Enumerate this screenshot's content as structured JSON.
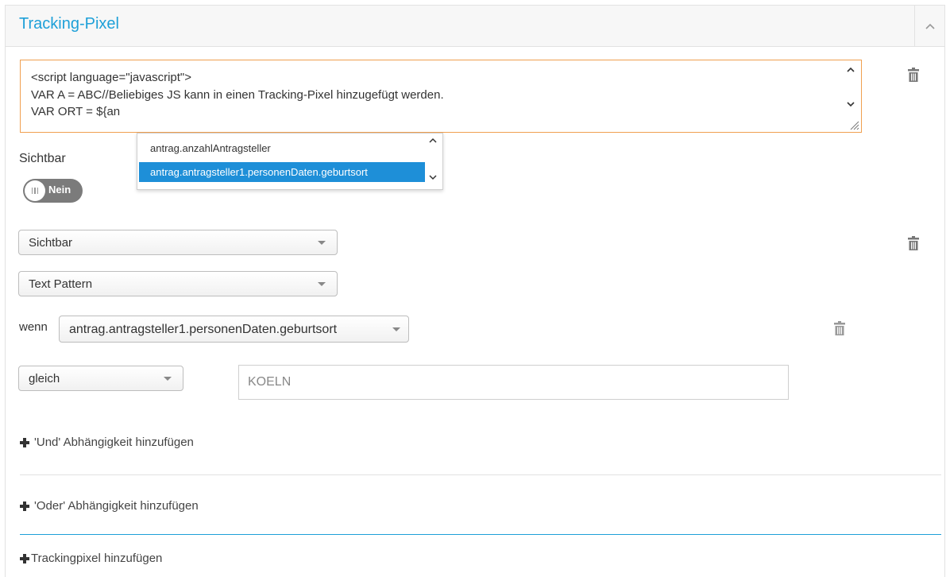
{
  "panel": {
    "title": "Tracking-Pixel",
    "collapse_icon": "chevron-up-icon"
  },
  "code_editor": {
    "lines": [
      "<script language=\"javascript\">",
      "VAR A = ABC//Beliebiges JS kann in einen Tracking-Pixel hinzugefügt werden.",
      "VAR ORT = ${an"
    ]
  },
  "autocomplete": {
    "items": [
      {
        "label": "antrag.anzahlAntragsteller",
        "selected": false
      },
      {
        "label": "antrag.antragsteller1.personenDaten.geburtsort",
        "selected": true
      }
    ]
  },
  "visibility": {
    "label": "Sichtbar",
    "toggle_text": "Nein"
  },
  "rule": {
    "action_select": "Sichtbar",
    "type_select": "Text Pattern",
    "wenn_label": "wenn",
    "field_select": "antrag.antragsteller1.personenDaten.geburtsort",
    "operator_select": "gleich",
    "value_input": "KOELN"
  },
  "links": {
    "and_dependency": "'Und' Abhängigkeit hinzufügen",
    "or_dependency": "'Oder' Abhängigkeit hinzufügen",
    "add_trackingpixel": "Trackingpixel hinzufügen"
  },
  "colors": {
    "accent": "#1ea0d8",
    "editor_focus_border": "#f0a050",
    "selected_item": "#1e8fd8"
  }
}
